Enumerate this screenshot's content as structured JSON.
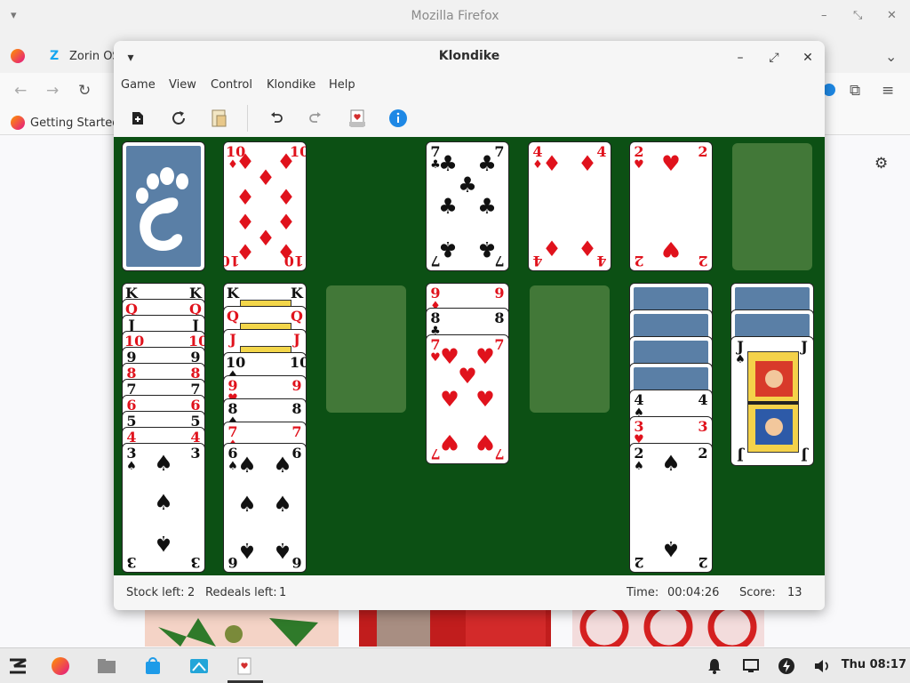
{
  "firefox": {
    "window_title": "Mozilla Firefox",
    "tabs": [
      {
        "label": "Zorin OS"
      }
    ],
    "bookmark": "Getting Started"
  },
  "klondike": {
    "title": "Klondike",
    "menu": [
      "Game",
      "View",
      "Control",
      "Klondike",
      "Help"
    ],
    "toolbar": [
      "new-game",
      "restart",
      "change-theme",
      "undo",
      "redo",
      "hint",
      "info"
    ],
    "status": {
      "stock_left_label": "Stock left:",
      "stock_left": "2",
      "redeals_label": "Redeals left:",
      "redeals": "1",
      "time_label": "Time:",
      "time": "00:04:26",
      "score_label": "Score:",
      "score": "13"
    },
    "foundations": [
      {
        "rank": "7",
        "suit": "♣",
        "color": "black"
      },
      {
        "rank": "4",
        "suit": "♦",
        "color": "red"
      },
      {
        "rank": "2",
        "suit": "♥",
        "color": "red"
      }
    ],
    "waste": {
      "rank": "10",
      "suit": "♦",
      "color": "red"
    },
    "tableau": {
      "col1": [
        "K",
        "Q",
        "J",
        "10",
        "9",
        "8",
        "7",
        "6",
        "5",
        "4",
        "3♠"
      ],
      "col2": [
        "K",
        "Q",
        "J",
        "10♠",
        "9♥",
        "8♠",
        "7♦",
        "6♠"
      ],
      "col4": [
        "9♦",
        "8♣",
        "7♥"
      ],
      "col6": [
        "4♠",
        "3♥",
        "2♠"
      ],
      "col7": [
        "J♠"
      ]
    }
  },
  "taskbar": {
    "clock": "Thu 08:17"
  },
  "colors": {
    "felt": "#0c5014",
    "card_back": "#5a7fa6",
    "red_suit": "#e0121c",
    "info_blue": "#1e88e5"
  }
}
